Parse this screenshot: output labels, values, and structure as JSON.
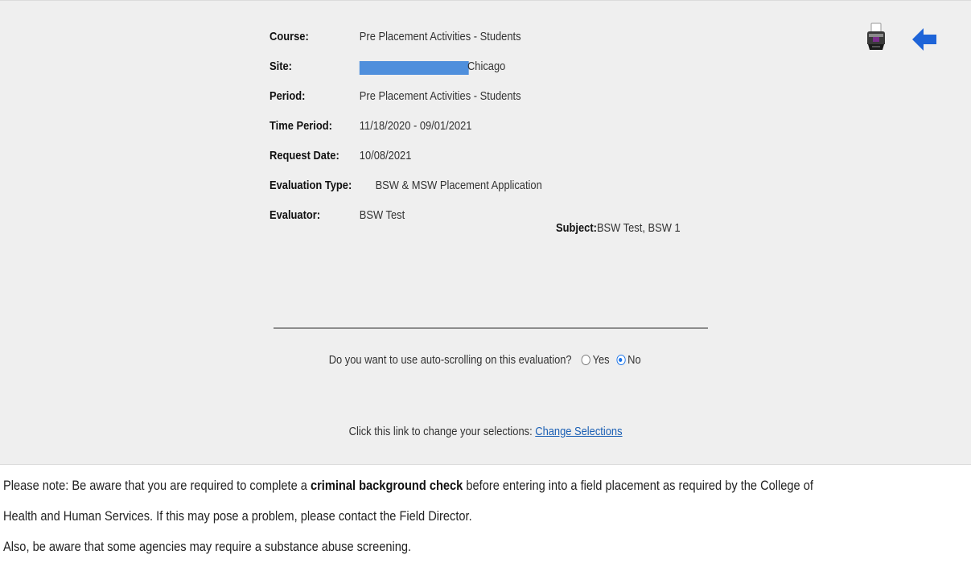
{
  "details": {
    "course_label": "Course:",
    "course_value": "Pre Placement Activities - Students",
    "site_label": "Site:",
    "site_value_suffix": "Chicago",
    "period_label": "Period:",
    "period_value": "Pre Placement Activities - Students",
    "time_period_label": "Time Period:",
    "time_period_value": "11/18/2020 - 09/01/2021",
    "request_date_label": "Request Date:",
    "request_date_value": "10/08/2021",
    "evaluation_type_label": "Evaluation Type:",
    "evaluation_type_value": "BSW & MSW Placement Application",
    "evaluator_label": "Evaluator:",
    "evaluator_value": "BSW Test",
    "subject_label": "Subject:",
    "subject_value": "BSW Test, BSW 1"
  },
  "autoscroll": {
    "question": "Do you want to use auto-scrolling on this evaluation?",
    "yes_label": "Yes",
    "no_label": "No",
    "selected": "No"
  },
  "change": {
    "prompt": "Click this link to change your selections:",
    "link_label": "Change Selections"
  },
  "icons": {
    "print": "printer-icon",
    "back": "back-arrow-icon",
    "accent_color": "#1a73e8"
  },
  "note": {
    "line1_prefix": "Please note: Be aware that you are required to complete a",
    "line1_bold": "criminal background check",
    "line1_suffix": "before entering into a field placement as required by the College of",
    "line2": "Health and Human Services. If this may pose a problem, please contact the Field Director.",
    "line3": "Also, be aware that some agencies may require a substance abuse screening."
  }
}
